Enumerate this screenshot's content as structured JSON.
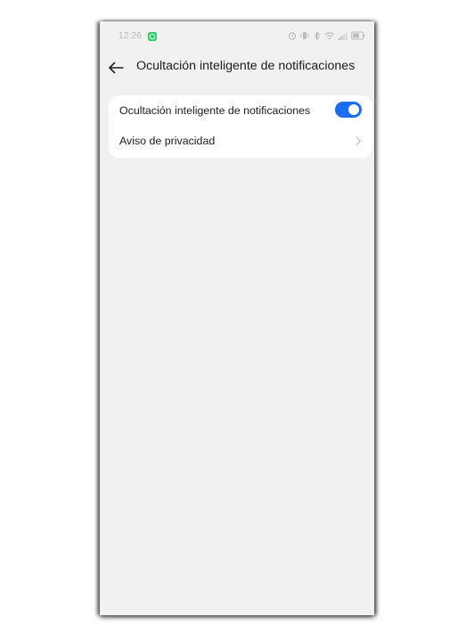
{
  "status_bar": {
    "time": "12:26",
    "icons": [
      "whatsapp-icon",
      "alarm-icon",
      "vibrate-icon",
      "bluetooth-icon",
      "wifi-icon",
      "signal-icon",
      "battery-icon"
    ]
  },
  "header": {
    "back_icon": "back-arrow-icon",
    "title": "Ocultación inteligente de notificaciones"
  },
  "settings": {
    "items": [
      {
        "label": "Ocultación inteligente de notificaciones",
        "control": "toggle",
        "enabled": true
      },
      {
        "label": "Aviso de privacidad",
        "control": "chevron-right-icon"
      }
    ]
  },
  "colors": {
    "accent": "#1a6cf0",
    "background": "#f1f1f1",
    "card": "#ffffff",
    "whatsapp": "#25d366"
  }
}
